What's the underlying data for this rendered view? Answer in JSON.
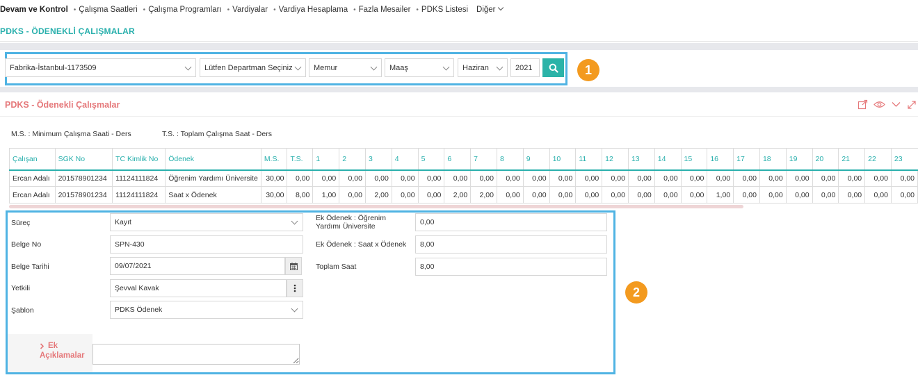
{
  "nav": {
    "brand": "Devam ve Kontrol",
    "items": [
      "Çalışma Saatleri",
      "Çalışma Programları",
      "Vardiyalar",
      "Vardiya Hesaplama",
      "Fazla Mesailer",
      "PDKS Listesi"
    ],
    "more": "Diğer"
  },
  "page_title": "PDKS - ÖDENEKLİ ÇALIŞMALAR",
  "filters": {
    "company": "Fabrika-İstanbul-1173509",
    "department": "Lütfen Departman Seçiniz",
    "staff_type": "Memur",
    "pay_type": "Maaş",
    "month": "Haziran",
    "year": "2021"
  },
  "badges": {
    "one": "1",
    "two": "2"
  },
  "section_title": "PDKS - Ödenekli Çalışmalar",
  "legend": {
    "ms": "M.S. : Minimum Çalışma Saati - Ders",
    "ts": "T.S. : Toplam Çalışma Saat - Ders"
  },
  "table": {
    "headers": [
      "Çalışan",
      "SGK No",
      "TC Kimlik No",
      "Ödenek",
      "M.S.",
      "T.S.",
      "1",
      "2",
      "3",
      "4",
      "5",
      "6",
      "7",
      "8",
      "9",
      "10",
      "11",
      "12",
      "13",
      "14",
      "15",
      "16",
      "17",
      "18",
      "19",
      "20",
      "21",
      "22",
      "23"
    ],
    "rows": [
      [
        "Ercan Adalı",
        "201578901234",
        "11124111824",
        "Öğrenim Yardımı Üniversite",
        "30,00",
        "0,00",
        "0,00",
        "0,00",
        "0,00",
        "0,00",
        "0,00",
        "0,00",
        "0,00",
        "0,00",
        "0,00",
        "0,00",
        "0,00",
        "0,00",
        "0,00",
        "0,00",
        "0,00",
        "0,00",
        "0,00",
        "0,00",
        "0,00",
        "0,00",
        "0,00",
        "0,00",
        "0,00"
      ],
      [
        "Ercan Adalı",
        "201578901234",
        "11124111824",
        "Saat x Ödenek",
        "30,00",
        "8,00",
        "1,00",
        "0,00",
        "2,00",
        "0,00",
        "0,00",
        "2,00",
        "2,00",
        "0,00",
        "0,00",
        "0,00",
        "0,00",
        "0,00",
        "0,00",
        "0,00",
        "0,00",
        "1,00",
        "0,00",
        "0,00",
        "0,00",
        "0,00",
        "0,00",
        "0,00",
        "0,00"
      ]
    ]
  },
  "form": {
    "surec_label": "Süreç",
    "surec_value": "Kayıt",
    "belge_no_label": "Belge No",
    "belge_no_value": "SPN-430",
    "belge_tarihi_label": "Belge Tarihi",
    "belge_tarihi_value": "09/07/2021",
    "yetkili_label": "Yetkili",
    "yetkili_value": "Şevval Kavak",
    "sablon_label": "Şablon",
    "sablon_value": "PDKS Ödenek",
    "ek1_label": "Ek Ödenek : Öğrenim Yardımı Üniversite",
    "ek1_value": "0,00",
    "ek2_label": "Ek Ödenek : Saat x Ödenek",
    "ek2_value": "8,00",
    "toplam_label": "Toplam Saat",
    "toplam_value": "8,00",
    "ek_aciklamalar_label": "Ek Açıklamalar",
    "ek_aciklamalar_value": ""
  },
  "colors": {
    "teal": "#2ab0ad",
    "highlight": "#4fb3e3",
    "badge": "#f39a1f",
    "section_red": "#e5787a"
  },
  "icons": [
    "search-icon",
    "share-icon",
    "eye-icon",
    "chevron-down-icon",
    "expand-icon",
    "calendar-icon",
    "more-vertical-icon",
    "chevron-right-icon"
  ]
}
